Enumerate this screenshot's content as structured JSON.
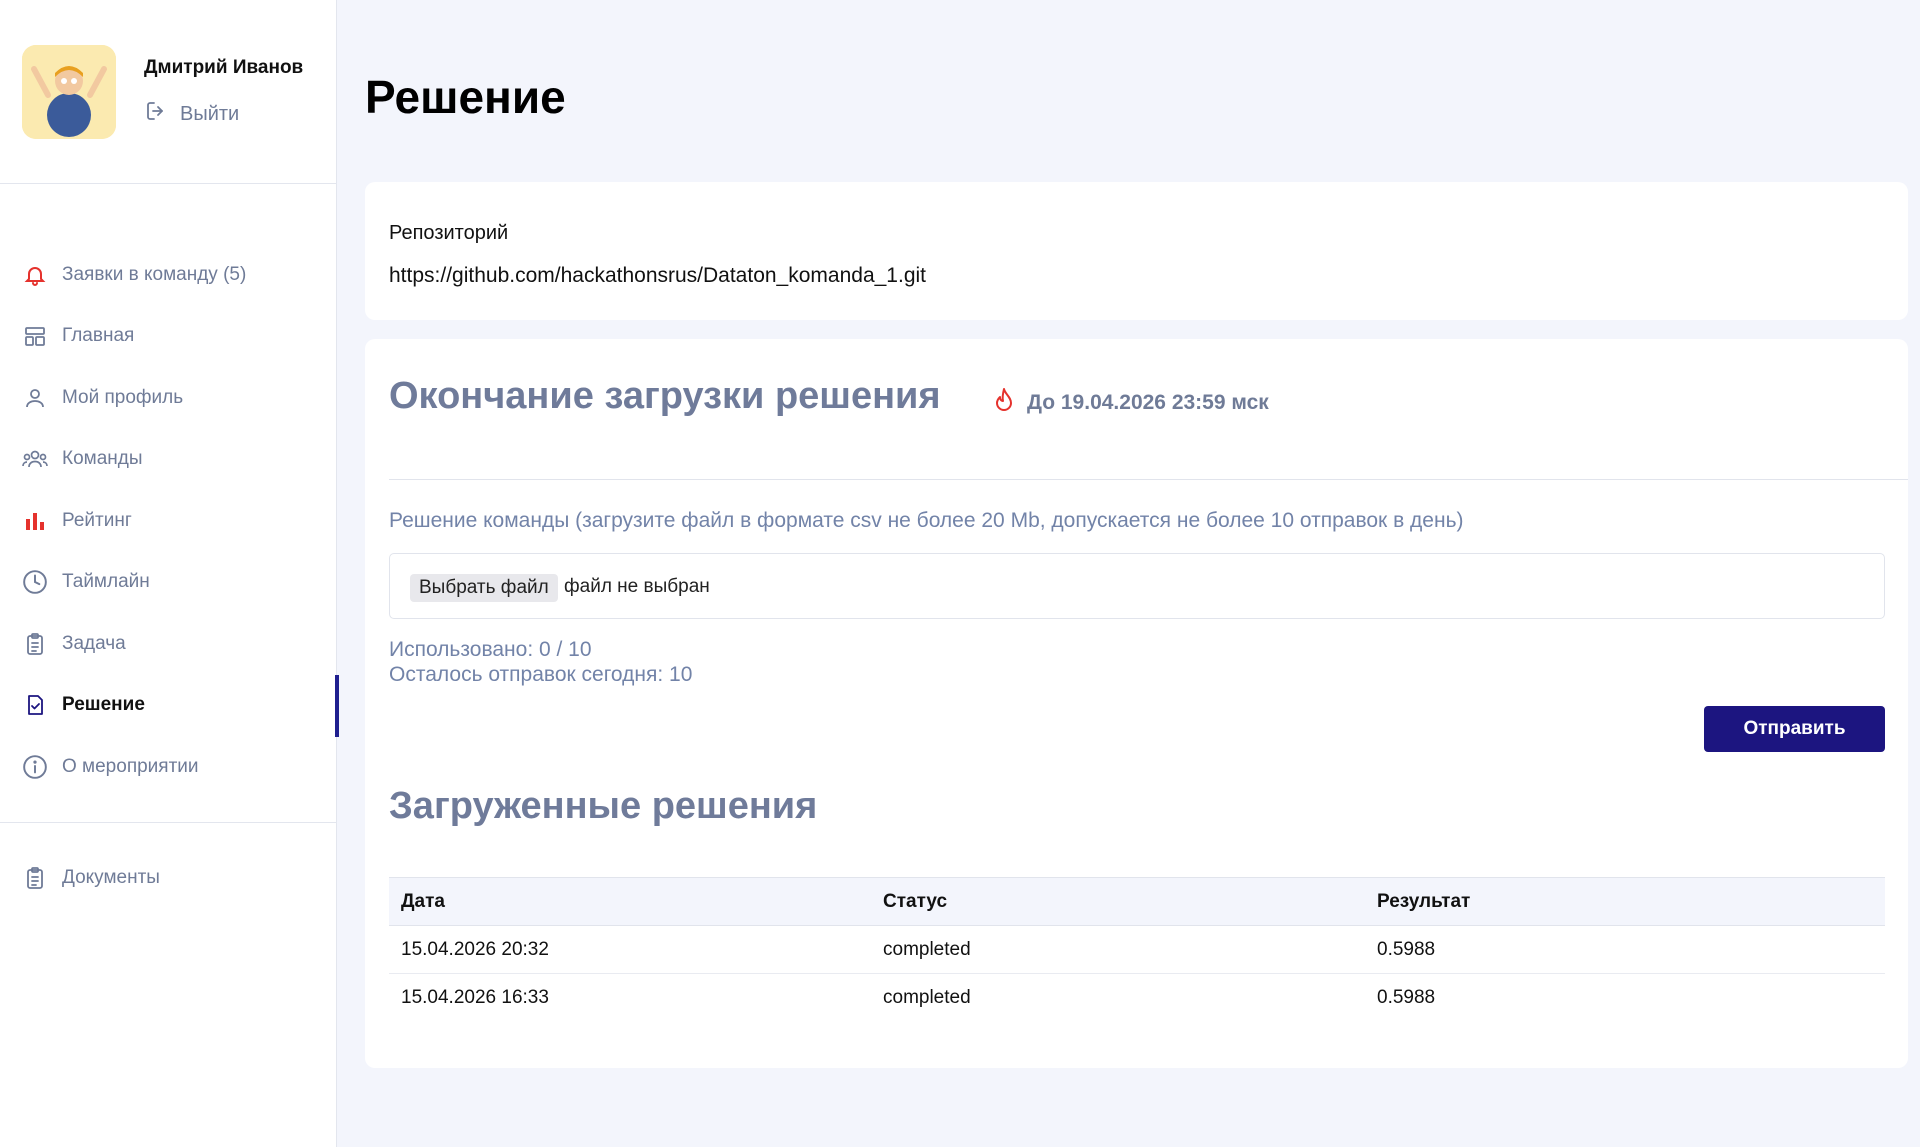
{
  "user": {
    "name": "Дмитрий Иванов",
    "logout": "Выйти"
  },
  "nav": {
    "items": [
      {
        "label": "Заявки в команду (5)",
        "icon": "bell-icon"
      },
      {
        "label": "Главная",
        "icon": "layout-icon"
      },
      {
        "label": "Мой профиль",
        "icon": "user-icon"
      },
      {
        "label": "Команды",
        "icon": "users-icon"
      },
      {
        "label": "Рейтинг",
        "icon": "bar-chart-icon"
      },
      {
        "label": "Таймлайн",
        "icon": "clock-icon"
      },
      {
        "label": "Задача",
        "icon": "clipboard-icon"
      },
      {
        "label": "Решение",
        "icon": "check-document-icon",
        "active": true
      },
      {
        "label": "О мероприятии",
        "icon": "info-icon"
      }
    ],
    "docs": {
      "label": "Документы",
      "icon": "clipboard-icon"
    }
  },
  "page": {
    "title": "Решение"
  },
  "repo": {
    "label": "Репозиторий",
    "url": "https://github.com/hackathonsrus/Dataton_komanda_1.git"
  },
  "solution": {
    "deadline_title": "Окончание загрузки решения",
    "deadline_when": "До 19.04.2026 23:59 мск",
    "upload_label": "Решение команды (загрузите файл в формате csv не более 20 Mb, допускается не более 10 отправок в день)",
    "file_button": "Выбрать файл",
    "file_status": "файл не выбран",
    "used": "Использовано: 0 / 10",
    "left_today": "Осталось отправок сегодня: 10",
    "send_button": "Отправить"
  },
  "uploads": {
    "title": "Загруженные решения",
    "columns": [
      "Дата",
      "Статус",
      "Результат"
    ],
    "rows": [
      [
        "15.04.2026 20:32",
        "completed",
        "0.5988"
      ],
      [
        "15.04.2026 16:33",
        "completed",
        "0.5988"
      ]
    ]
  },
  "colors": {
    "accent": "#1c1580",
    "muted": "#6f7b97",
    "alert": "#e5322d"
  }
}
